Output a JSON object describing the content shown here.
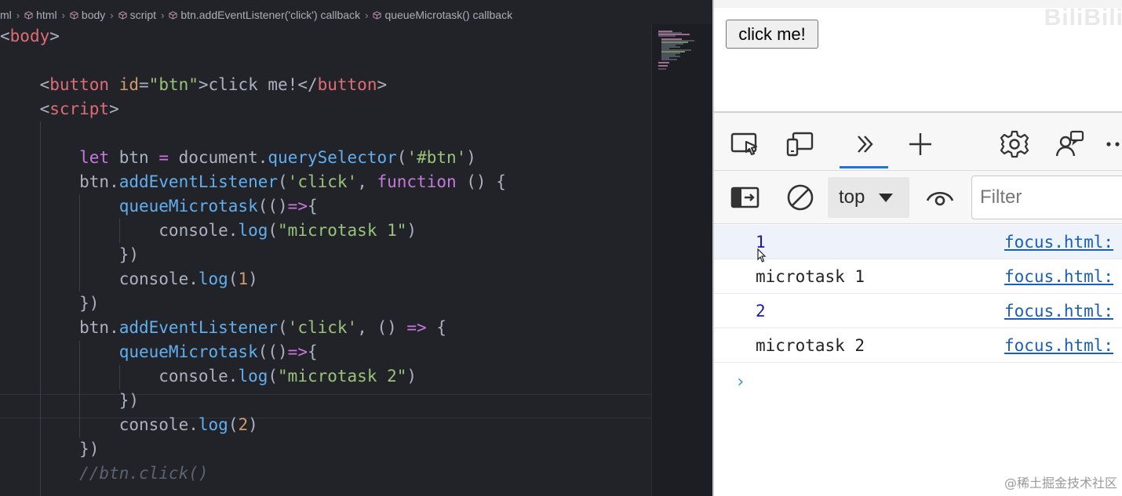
{
  "breadcrumb": [
    {
      "label": "ml"
    },
    {
      "label": "html"
    },
    {
      "label": "body"
    },
    {
      "label": "script"
    },
    {
      "label": "btn.addEventListener('click') callback"
    },
    {
      "label": "queueMicrotask() callback"
    }
  ],
  "editor": {
    "lines": [
      [
        {
          "t": "<",
          "c": "punc"
        },
        {
          "t": "body",
          "c": "tag"
        },
        {
          "t": ">",
          "c": "punc"
        }
      ],
      [],
      [
        {
          "t": "    <",
          "c": "punc"
        },
        {
          "t": "button",
          "c": "tag"
        },
        {
          "t": " id",
          "c": "attr"
        },
        {
          "t": "=",
          "c": "punc"
        },
        {
          "t": "\"btn\"",
          "c": "str"
        },
        {
          "t": ">click me!</",
          "c": "punc"
        },
        {
          "t": "button",
          "c": "tag"
        },
        {
          "t": ">",
          "c": "punc"
        }
      ],
      [
        {
          "t": "    <",
          "c": "punc"
        },
        {
          "t": "script",
          "c": "tag"
        },
        {
          "t": ">",
          "c": "punc"
        }
      ],
      [],
      [
        {
          "t": "        ",
          "c": "punc"
        },
        {
          "t": "let",
          "c": "kw"
        },
        {
          "t": " btn ",
          "c": "punc"
        },
        {
          "t": "=",
          "c": "kw"
        },
        {
          "t": " document.",
          "c": "punc"
        },
        {
          "t": "querySelector",
          "c": "fn"
        },
        {
          "t": "(",
          "c": "punc"
        },
        {
          "t": "'#btn'",
          "c": "str"
        },
        {
          "t": ")",
          "c": "punc"
        }
      ],
      [
        {
          "t": "        btn.",
          "c": "punc"
        },
        {
          "t": "addEventListener",
          "c": "fn"
        },
        {
          "t": "(",
          "c": "punc"
        },
        {
          "t": "'click'",
          "c": "str"
        },
        {
          "t": ", ",
          "c": "punc"
        },
        {
          "t": "function",
          "c": "kw"
        },
        {
          "t": " () {",
          "c": "punc"
        }
      ],
      [
        {
          "t": "            ",
          "c": "punc"
        },
        {
          "t": "queueMicrotask",
          "c": "fn"
        },
        {
          "t": "(()",
          "c": "punc"
        },
        {
          "t": "=>",
          "c": "kw"
        },
        {
          "t": "{",
          "c": "punc"
        }
      ],
      [
        {
          "t": "                console.",
          "c": "punc"
        },
        {
          "t": "log",
          "c": "fn"
        },
        {
          "t": "(",
          "c": "punc"
        },
        {
          "t": "\"microtask 1\"",
          "c": "str"
        },
        {
          "t": ")",
          "c": "punc"
        }
      ],
      [
        {
          "t": "            })",
          "c": "punc"
        }
      ],
      [
        {
          "t": "            console.",
          "c": "punc"
        },
        {
          "t": "log",
          "c": "fn"
        },
        {
          "t": "(",
          "c": "punc"
        },
        {
          "t": "1",
          "c": "num"
        },
        {
          "t": ")",
          "c": "punc"
        }
      ],
      [
        {
          "t": "        })",
          "c": "punc"
        }
      ],
      [
        {
          "t": "        btn.",
          "c": "punc"
        },
        {
          "t": "addEventListener",
          "c": "fn"
        },
        {
          "t": "(",
          "c": "punc"
        },
        {
          "t": "'click'",
          "c": "str"
        },
        {
          "t": ", () ",
          "c": "punc"
        },
        {
          "t": "=>",
          "c": "kw"
        },
        {
          "t": " {",
          "c": "punc"
        }
      ],
      [
        {
          "t": "            ",
          "c": "punc"
        },
        {
          "t": "queueMicrotask",
          "c": "fn"
        },
        {
          "t": "(()",
          "c": "punc"
        },
        {
          "t": "=>",
          "c": "kw"
        },
        {
          "t": "{",
          "c": "punc"
        }
      ],
      [
        {
          "t": "                console.",
          "c": "punc"
        },
        {
          "t": "log",
          "c": "fn"
        },
        {
          "t": "(",
          "c": "punc"
        },
        {
          "t": "\"microtask 2\"",
          "c": "str"
        },
        {
          "t": ")",
          "c": "punc"
        }
      ],
      [
        {
          "t": "            })",
          "c": "punc"
        }
      ],
      [
        {
          "t": "            console.",
          "c": "punc"
        },
        {
          "t": "log",
          "c": "fn"
        },
        {
          "t": "(",
          "c": "punc"
        },
        {
          "t": "2",
          "c": "num"
        },
        {
          "t": ")",
          "c": "punc"
        }
      ],
      [
        {
          "t": "        })",
          "c": "punc"
        }
      ],
      [
        {
          "t": "        //btn.click()",
          "c": "com"
        }
      ]
    ]
  },
  "browser": {
    "page_button_label": "click me!",
    "watermark_top": "BiliBili"
  },
  "devtools": {
    "context_label": "top",
    "filter_placeholder": "Filter",
    "console_rows": [
      {
        "message": "1",
        "source": "focus.html:",
        "type": "number"
      },
      {
        "message": "microtask 1",
        "source": "focus.html:",
        "type": "string"
      },
      {
        "message": "2",
        "source": "focus.html:",
        "type": "number"
      },
      {
        "message": "microtask 2",
        "source": "focus.html:",
        "type": "string"
      }
    ],
    "prompt_symbol": "›"
  },
  "watermark": "@稀土掘金技术社区"
}
